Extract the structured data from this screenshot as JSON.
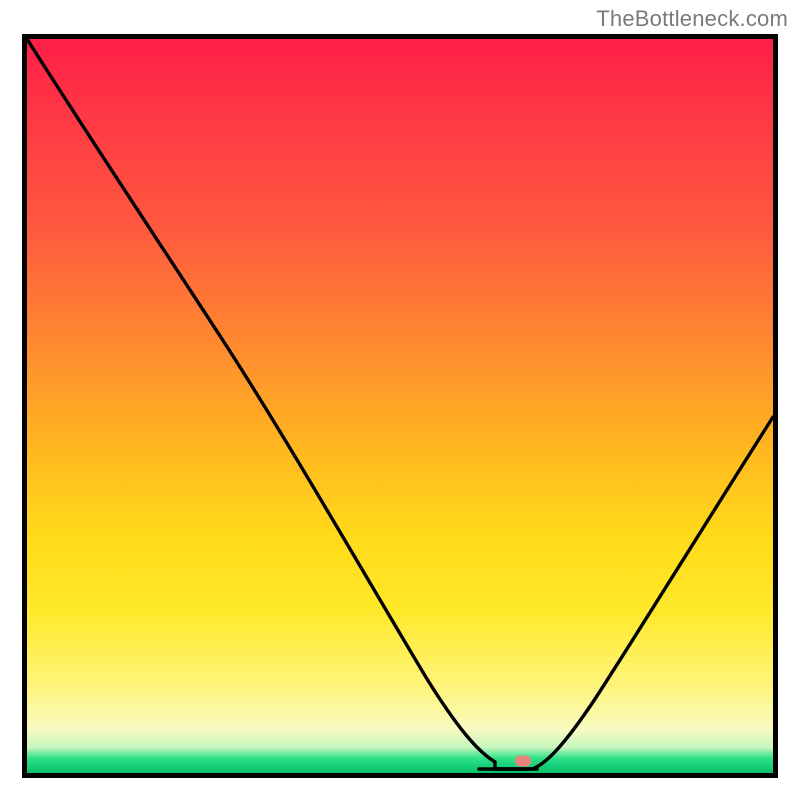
{
  "attribution": "TheBottleneck.com",
  "chart_data": {
    "type": "line",
    "title": "",
    "xlabel": "",
    "ylabel": "",
    "xlim": [
      0,
      100
    ],
    "ylim": [
      0,
      100
    ],
    "grid": false,
    "legend": false,
    "annotations": [
      {
        "name": "optimal-point-marker",
        "x": 66,
        "y": 0,
        "color": "#e8847c"
      }
    ],
    "background_gradient": {
      "direction": "vertical",
      "stops": [
        {
          "pos": 0,
          "color": "#ff1f48"
        },
        {
          "pos": 0.42,
          "color": "#ff8b2f"
        },
        {
          "pos": 0.68,
          "color": "#ffdb1a"
        },
        {
          "pos": 0.94,
          "color": "#f8fbc0"
        },
        {
          "pos": 1.0,
          "color": "#06c06b"
        }
      ]
    },
    "series": [
      {
        "name": "bottleneck-curve",
        "color": "#000000",
        "x": [
          0,
          10,
          20,
          30,
          40,
          50,
          58,
          62,
          66,
          70,
          76,
          84,
          92,
          100
        ],
        "y": [
          100,
          85,
          70,
          55,
          40,
          24,
          10,
          3,
          0,
          3,
          14,
          30,
          42,
          50
        ]
      }
    ],
    "notes": "y-axis values are approximate bottleneck percentage (100 = worst at top, 0 = best at bottom). Minimum near x≈66."
  }
}
